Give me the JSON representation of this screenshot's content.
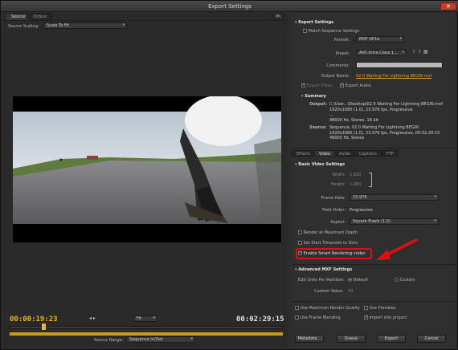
{
  "window": {
    "title": "Export Settings"
  },
  "left": {
    "tabs": [
      "Source",
      "Output"
    ],
    "source_scaling_label": "Source Scaling:",
    "source_scaling_value": "Scale To Fit",
    "timecode_in": "00:00:19:23",
    "timecode_out": "00:02:29:15",
    "fit_value": "Fit",
    "source_range_label": "Source Range:",
    "source_range_value": "Sequence In/Out"
  },
  "export_settings": {
    "header": "Export Settings",
    "match_sequence": "Match Sequence Settings",
    "format_label": "Format:",
    "format_value": "MXF OP1a",
    "preset_label": "Preset:",
    "preset_value": "AVC-Intra Class 1...",
    "comments_label": "Comments:",
    "output_name_label": "Output Name:",
    "output_name_value": "02.0 Waiting For Lightning BEGIN.mxf",
    "export_video": "Export Video",
    "export_audio": "Export Audio"
  },
  "summary": {
    "header": "Summary",
    "output_label": "Output:",
    "output_lines": [
      "C:\\User...\\Desktop\\02.0 Waiting For Lightning BEGIN.mxf",
      "1920x1080 (1.0), 23.976 fps, Progressive",
      "...",
      "48000 Hz, Stereo, 16 bit"
    ],
    "source_label": "Source:",
    "source_lines": [
      "Sequence, 02.0 Waiting For Lightning BEGIN",
      "1920x1080 (1.0), 23.976 fps, Progressive, 00:02:29:15",
      "48000 Hz, Stereo"
    ]
  },
  "subtabs": [
    "Effects",
    "Video",
    "Audio",
    "Captions",
    "FTP"
  ],
  "video": {
    "basic_header": "Basic Video Settings",
    "width_label": "Width:",
    "width_value": "1,920",
    "height_label": "Height:",
    "height_value": "1,080",
    "frame_rate_label": "Frame Rate:",
    "frame_rate_value": "23.976",
    "field_order_label": "Field Order:",
    "field_order_value": "Progressive",
    "aspect_label": "Aspect:",
    "aspect_value": "Square Pixels (1.0)",
    "render_max_depth": "Render at Maximum Depth",
    "set_start_timecode": "Set Start Timecode to Zero",
    "enable_smart_rendering": "Enable Smart Rendering codec",
    "advanced_header": "Advanced MXF Settings",
    "edit_units_label": "Edit Units Per Partition:",
    "default_option": "Default",
    "custom_option": "Custom",
    "custom_value_label": "Custom Value:",
    "custom_value": "20"
  },
  "bottom": {
    "use_max_render_quality": "Use Maximum Render Quality",
    "use_previews": "Use Previews",
    "use_frame_blending": "Use Frame Blending",
    "import_into_project": "Import into project",
    "metadata_btn": "Metadata...",
    "queue_btn": "Queue",
    "export_btn": "Export",
    "cancel_btn": "Cancel"
  },
  "colors": {
    "highlight_red": "#e01010",
    "timecode_yellow": "#e8b52a",
    "link_orange": "#e0a52a"
  }
}
